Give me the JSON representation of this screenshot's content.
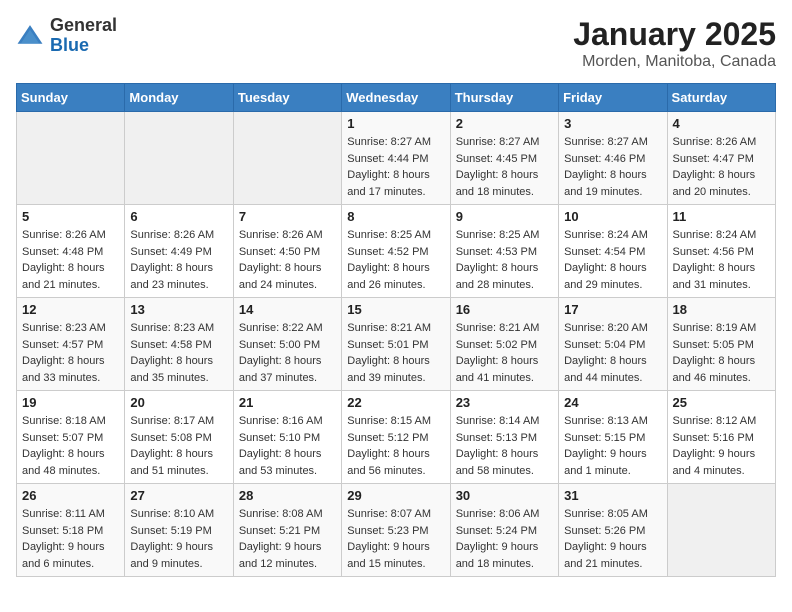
{
  "logo": {
    "general": "General",
    "blue": "Blue"
  },
  "title": "January 2025",
  "subtitle": "Morden, Manitoba, Canada",
  "weekdays": [
    "Sunday",
    "Monday",
    "Tuesday",
    "Wednesday",
    "Thursday",
    "Friday",
    "Saturday"
  ],
  "weeks": [
    [
      {
        "day": "",
        "sunrise": "",
        "sunset": "",
        "daylight": ""
      },
      {
        "day": "",
        "sunrise": "",
        "sunset": "",
        "daylight": ""
      },
      {
        "day": "",
        "sunrise": "",
        "sunset": "",
        "daylight": ""
      },
      {
        "day": "1",
        "sunrise": "Sunrise: 8:27 AM",
        "sunset": "Sunset: 4:44 PM",
        "daylight": "Daylight: 8 hours and 17 minutes."
      },
      {
        "day": "2",
        "sunrise": "Sunrise: 8:27 AM",
        "sunset": "Sunset: 4:45 PM",
        "daylight": "Daylight: 8 hours and 18 minutes."
      },
      {
        "day": "3",
        "sunrise": "Sunrise: 8:27 AM",
        "sunset": "Sunset: 4:46 PM",
        "daylight": "Daylight: 8 hours and 19 minutes."
      },
      {
        "day": "4",
        "sunrise": "Sunrise: 8:26 AM",
        "sunset": "Sunset: 4:47 PM",
        "daylight": "Daylight: 8 hours and 20 minutes."
      }
    ],
    [
      {
        "day": "5",
        "sunrise": "Sunrise: 8:26 AM",
        "sunset": "Sunset: 4:48 PM",
        "daylight": "Daylight: 8 hours and 21 minutes."
      },
      {
        "day": "6",
        "sunrise": "Sunrise: 8:26 AM",
        "sunset": "Sunset: 4:49 PM",
        "daylight": "Daylight: 8 hours and 23 minutes."
      },
      {
        "day": "7",
        "sunrise": "Sunrise: 8:26 AM",
        "sunset": "Sunset: 4:50 PM",
        "daylight": "Daylight: 8 hours and 24 minutes."
      },
      {
        "day": "8",
        "sunrise": "Sunrise: 8:25 AM",
        "sunset": "Sunset: 4:52 PM",
        "daylight": "Daylight: 8 hours and 26 minutes."
      },
      {
        "day": "9",
        "sunrise": "Sunrise: 8:25 AM",
        "sunset": "Sunset: 4:53 PM",
        "daylight": "Daylight: 8 hours and 28 minutes."
      },
      {
        "day": "10",
        "sunrise": "Sunrise: 8:24 AM",
        "sunset": "Sunset: 4:54 PM",
        "daylight": "Daylight: 8 hours and 29 minutes."
      },
      {
        "day": "11",
        "sunrise": "Sunrise: 8:24 AM",
        "sunset": "Sunset: 4:56 PM",
        "daylight": "Daylight: 8 hours and 31 minutes."
      }
    ],
    [
      {
        "day": "12",
        "sunrise": "Sunrise: 8:23 AM",
        "sunset": "Sunset: 4:57 PM",
        "daylight": "Daylight: 8 hours and 33 minutes."
      },
      {
        "day": "13",
        "sunrise": "Sunrise: 8:23 AM",
        "sunset": "Sunset: 4:58 PM",
        "daylight": "Daylight: 8 hours and 35 minutes."
      },
      {
        "day": "14",
        "sunrise": "Sunrise: 8:22 AM",
        "sunset": "Sunset: 5:00 PM",
        "daylight": "Daylight: 8 hours and 37 minutes."
      },
      {
        "day": "15",
        "sunrise": "Sunrise: 8:21 AM",
        "sunset": "Sunset: 5:01 PM",
        "daylight": "Daylight: 8 hours and 39 minutes."
      },
      {
        "day": "16",
        "sunrise": "Sunrise: 8:21 AM",
        "sunset": "Sunset: 5:02 PM",
        "daylight": "Daylight: 8 hours and 41 minutes."
      },
      {
        "day": "17",
        "sunrise": "Sunrise: 8:20 AM",
        "sunset": "Sunset: 5:04 PM",
        "daylight": "Daylight: 8 hours and 44 minutes."
      },
      {
        "day": "18",
        "sunrise": "Sunrise: 8:19 AM",
        "sunset": "Sunset: 5:05 PM",
        "daylight": "Daylight: 8 hours and 46 minutes."
      }
    ],
    [
      {
        "day": "19",
        "sunrise": "Sunrise: 8:18 AM",
        "sunset": "Sunset: 5:07 PM",
        "daylight": "Daylight: 8 hours and 48 minutes."
      },
      {
        "day": "20",
        "sunrise": "Sunrise: 8:17 AM",
        "sunset": "Sunset: 5:08 PM",
        "daylight": "Daylight: 8 hours and 51 minutes."
      },
      {
        "day": "21",
        "sunrise": "Sunrise: 8:16 AM",
        "sunset": "Sunset: 5:10 PM",
        "daylight": "Daylight: 8 hours and 53 minutes."
      },
      {
        "day": "22",
        "sunrise": "Sunrise: 8:15 AM",
        "sunset": "Sunset: 5:12 PM",
        "daylight": "Daylight: 8 hours and 56 minutes."
      },
      {
        "day": "23",
        "sunrise": "Sunrise: 8:14 AM",
        "sunset": "Sunset: 5:13 PM",
        "daylight": "Daylight: 8 hours and 58 minutes."
      },
      {
        "day": "24",
        "sunrise": "Sunrise: 8:13 AM",
        "sunset": "Sunset: 5:15 PM",
        "daylight": "Daylight: 9 hours and 1 minute."
      },
      {
        "day": "25",
        "sunrise": "Sunrise: 8:12 AM",
        "sunset": "Sunset: 5:16 PM",
        "daylight": "Daylight: 9 hours and 4 minutes."
      }
    ],
    [
      {
        "day": "26",
        "sunrise": "Sunrise: 8:11 AM",
        "sunset": "Sunset: 5:18 PM",
        "daylight": "Daylight: 9 hours and 6 minutes."
      },
      {
        "day": "27",
        "sunrise": "Sunrise: 8:10 AM",
        "sunset": "Sunset: 5:19 PM",
        "daylight": "Daylight: 9 hours and 9 minutes."
      },
      {
        "day": "28",
        "sunrise": "Sunrise: 8:08 AM",
        "sunset": "Sunset: 5:21 PM",
        "daylight": "Daylight: 9 hours and 12 minutes."
      },
      {
        "day": "29",
        "sunrise": "Sunrise: 8:07 AM",
        "sunset": "Sunset: 5:23 PM",
        "daylight": "Daylight: 9 hours and 15 minutes."
      },
      {
        "day": "30",
        "sunrise": "Sunrise: 8:06 AM",
        "sunset": "Sunset: 5:24 PM",
        "daylight": "Daylight: 9 hours and 18 minutes."
      },
      {
        "day": "31",
        "sunrise": "Sunrise: 8:05 AM",
        "sunset": "Sunset: 5:26 PM",
        "daylight": "Daylight: 9 hours and 21 minutes."
      },
      {
        "day": "",
        "sunrise": "",
        "sunset": "",
        "daylight": ""
      }
    ]
  ]
}
